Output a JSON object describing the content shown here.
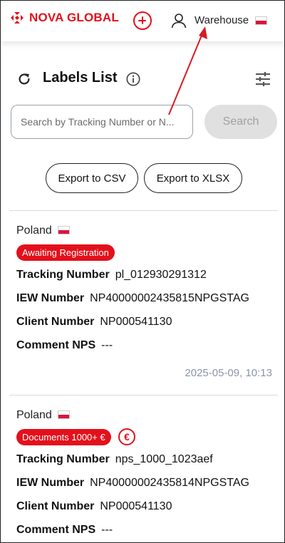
{
  "header": {
    "logo_text": "NOVA GLOBAL",
    "warehouse_label": "Warehouse",
    "brand_color": "#e3101b"
  },
  "toolbar": {
    "title": "Labels List"
  },
  "search": {
    "placeholder": "Search by Tracking Number or N...",
    "value": "",
    "button_label": "Search"
  },
  "export": {
    "csv_label": "Export to CSV",
    "xlsx_label": "Export to XLSX"
  },
  "labels": [
    {
      "country": "Poland",
      "status": "Awaiting Registration",
      "fields": [
        {
          "key": "Tracking Number",
          "value": "pl_012930291312"
        },
        {
          "key": "IEW Number",
          "value": "NP40000002435815NPGSTAG"
        },
        {
          "key": "Client Number",
          "value": "NP000541130"
        },
        {
          "key": "Comment NPS",
          "value": "---"
        }
      ],
      "date": "2025-05-09, 10:13"
    },
    {
      "country": "Poland",
      "status": "Documents 1000+ €",
      "euro_symbol": "€",
      "fields": [
        {
          "key": "Tracking Number",
          "value": "nps_1000_1023aef"
        },
        {
          "key": "IEW Number",
          "value": "NP40000002435814NPGSTAG"
        },
        {
          "key": "Client Number",
          "value": "NP000541130"
        },
        {
          "key": "Comment NPS",
          "value": "---"
        }
      ]
    }
  ]
}
